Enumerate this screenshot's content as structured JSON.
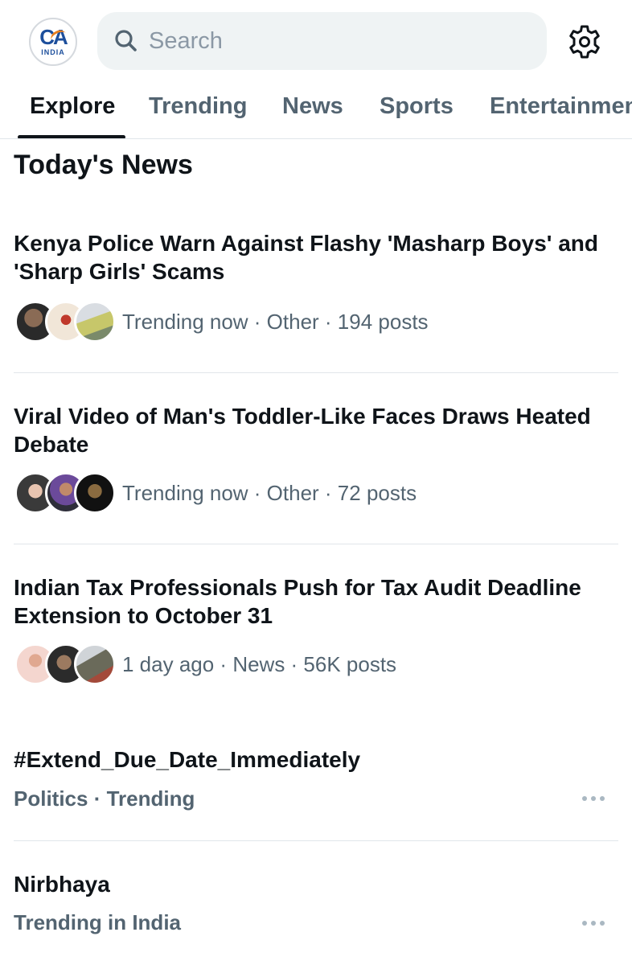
{
  "header": {
    "logo_text": "CA",
    "logo_subtext": "INDIA",
    "search_placeholder": "Search"
  },
  "tabs": [
    {
      "label": "Explore",
      "active": true
    },
    {
      "label": "Trending",
      "active": false
    },
    {
      "label": "News",
      "active": false
    },
    {
      "label": "Sports",
      "active": false
    },
    {
      "label": "Entertainment",
      "active": false
    }
  ],
  "section_title": "Today's News",
  "news": [
    {
      "title": "Kenya Police Warn Against Flashy 'Masharp Boys' and 'Sharp Girls' Scams",
      "meta": "Trending now · Other · 194 posts"
    },
    {
      "title": "Viral Video of Man's Toddler-Like Faces Draws Heated Debate",
      "meta": "Trending now · Other · 72 posts"
    },
    {
      "title": "Indian Tax Professionals Push for Tax Audit Deadline Extension to October 31",
      "meta": "1 day ago · News · 56K posts"
    }
  ],
  "trends": [
    {
      "title": "#Extend_Due_Date_Immediately",
      "subtitle": "Politics · Trending"
    },
    {
      "title": "Nirbhaya",
      "subtitle": "Trending in India"
    }
  ],
  "colors": {
    "text_primary": "#0f1419",
    "text_secondary": "#536471",
    "search_bg": "#eff3f4",
    "divider": "#e1e6ea"
  },
  "icons": [
    "search-icon",
    "settings-gear-icon",
    "more-options-icon"
  ]
}
